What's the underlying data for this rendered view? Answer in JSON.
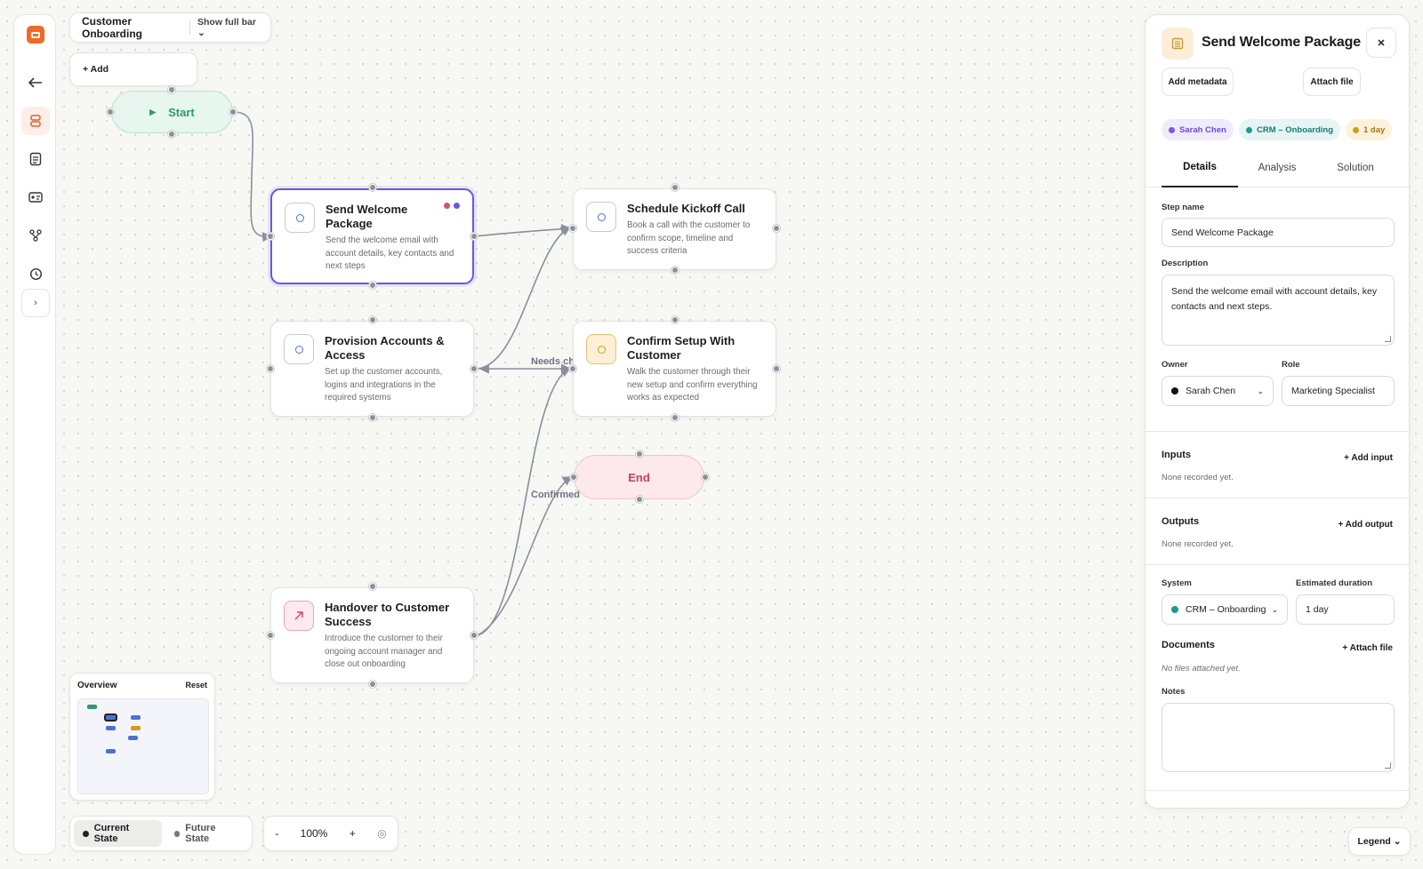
{
  "toolbar": {
    "workflow_name": "Customer Onboarding",
    "show_full_bar": "Show full bar",
    "add_label": "+ Add"
  },
  "nodes": {
    "start": "Start",
    "end": "End",
    "send_welcome": {
      "title": "Send Welcome Package",
      "desc": "Send the welcome email with account details, key contacts and next steps",
      "dot_colors": [
        "#d94f6a",
        "#6a55e6"
      ]
    },
    "schedule_kickoff": {
      "title": "Schedule Kickoff Call",
      "desc": "Book a call with the customer to confirm scope, timeline and success criteria"
    },
    "provision": {
      "title": "Provision Accounts & Access",
      "desc": "Set up the customer accounts, logins and integrations in the required systems"
    },
    "confirm_setup": {
      "title": "Confirm Setup With Customer",
      "desc": "Walk the customer through their new setup and confirm everything works as expected"
    },
    "handover": {
      "title": "Handover to Customer Success",
      "desc": "Introduce the customer to their ongoing account manager and close out onboarding"
    }
  },
  "edges": {
    "needs_changes": "Needs ch",
    "confirmed": "Confirmed"
  },
  "overview": {
    "title": "Overview",
    "reset": "Reset"
  },
  "bottom": {
    "current_state": "Current State",
    "future_state": "Future State",
    "zoom_out": "-",
    "zoom": "100%",
    "zoom_in": "+",
    "legend": "Legend"
  },
  "panel": {
    "title": "Send Welcome Package",
    "add_metadata": "Add metadata",
    "attach_file": "Attach file",
    "tags": {
      "owner": "Sarah Chen",
      "system": "CRM – Onboarding",
      "duration": "1 day"
    },
    "tabs": [
      "Details",
      "Analysis",
      "Solution"
    ],
    "step_name_label": "Step name",
    "step_name": "Send Welcome Package",
    "description_label": "Description",
    "description": "Send the welcome email with account details, key contacts and next steps.",
    "owner_label": "Owner",
    "owner": "Sarah Chen",
    "role_label": "Role",
    "role": "Marketing Specialist",
    "inputs_label": "Inputs",
    "add_input": "+ Add input",
    "inputs_empty": "None recorded yet.",
    "outputs_label": "Outputs",
    "add_output": "+ Add output",
    "outputs_empty": "None recorded yet.",
    "system_label": "System",
    "system": "CRM – Onboarding",
    "duration_label": "Estimated duration",
    "duration": "1 day",
    "documents_label": "Documents",
    "attach_doc": "+ Attach file",
    "documents_empty": "No files attached yet.",
    "notes_label": "Notes",
    "notes": ""
  },
  "colors": {
    "accent": "#6558ea",
    "brand": "#f06a25",
    "start_green": "#2f9a6a",
    "end_red": "#c8415a",
    "owner_dot": "#7b5be0",
    "system_dot": "#1c9a8c",
    "duration_dot": "#d29b1e"
  }
}
